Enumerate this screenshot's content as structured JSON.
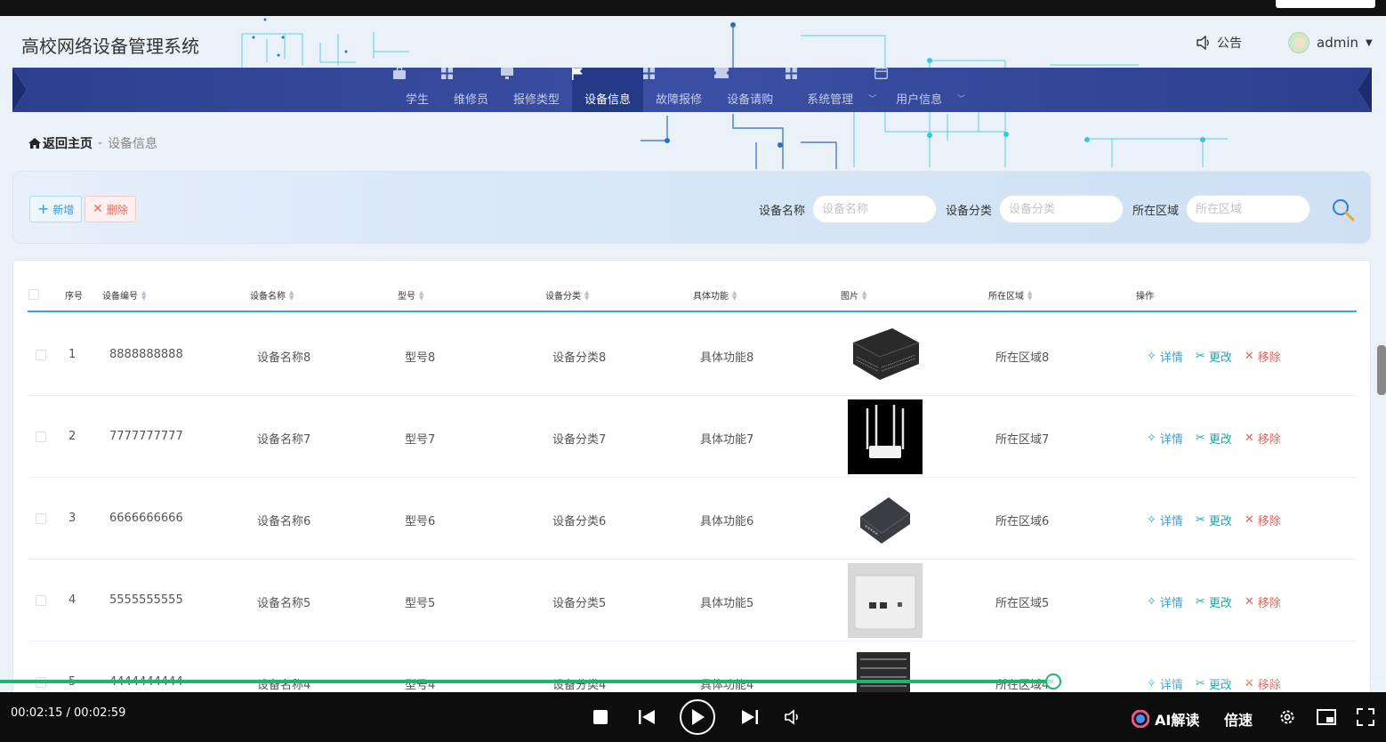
{
  "app": {
    "title": "高校网络设备管理系统"
  },
  "header": {
    "notice": "公告",
    "user": "admin"
  },
  "nav": {
    "items": [
      {
        "label": "学生",
        "icon": "briefcase-icon"
      },
      {
        "label": "维修员",
        "icon": "grid-icon"
      },
      {
        "label": "报修类型",
        "icon": "monitor-icon"
      },
      {
        "label": "设备信息",
        "icon": "flag-icon",
        "active": true
      },
      {
        "label": "故障报修",
        "icon": "grid-icon"
      },
      {
        "label": "设备请购",
        "icon": "ticket-icon"
      },
      {
        "label": "系统管理",
        "icon": "grid-icon",
        "has_sub": true
      },
      {
        "label": "用户信息",
        "icon": "card-icon",
        "has_sub": true
      }
    ],
    "active_color": "#243a86"
  },
  "breadcrumb": {
    "home": "返回主页",
    "sep": "-",
    "current": "设备信息"
  },
  "toolbar": {
    "add_label": "新增",
    "delete_label": "删除"
  },
  "filters": {
    "name_label": "设备名称",
    "name_placeholder": "设备名称",
    "category_label": "设备分类",
    "category_placeholder": "设备分类",
    "area_label": "所在区域",
    "area_placeholder": "所在区域"
  },
  "table": {
    "columns": [
      "序号",
      "设备编号",
      "设备名称",
      "型号",
      "设备分类",
      "具体功能",
      "图片",
      "所在区域",
      "操作"
    ],
    "rows": [
      {
        "index": "1",
        "code": "8888888888",
        "name": "设备名称8",
        "model": "型号8",
        "category": "设备分类8",
        "function": "具体功能8",
        "image": "network-switch-image",
        "area": "所在区域8"
      },
      {
        "index": "2",
        "code": "7777777777",
        "name": "设备名称7",
        "model": "型号7",
        "category": "设备分类7",
        "function": "具体功能7",
        "image": "wifi-router-image",
        "area": "所在区域7"
      },
      {
        "index": "3",
        "code": "6666666666",
        "name": "设备名称6",
        "model": "型号6",
        "category": "设备分类6",
        "function": "具体功能6",
        "image": "small-switch-image",
        "area": "所在区域6"
      },
      {
        "index": "4",
        "code": "5555555555",
        "name": "设备名称5",
        "model": "型号5",
        "category": "设备分类5",
        "function": "具体功能5",
        "image": "wall-panel-image",
        "area": "所在区域5"
      },
      {
        "index": "5",
        "code": "4444444444",
        "name": "设备名称4",
        "model": "型号4",
        "category": "设备分类4",
        "function": "具体功能4",
        "image": "chassis-switch-image",
        "area": "所在区域4"
      }
    ],
    "ops": {
      "detail": "详情",
      "edit": "更改",
      "remove": "移除"
    }
  },
  "video": {
    "time": "00:02:15 / 00:02:59",
    "progress": 0.76,
    "ai_label": "AI解读",
    "speed_label": "倍速",
    "accent": "#19b86b"
  }
}
